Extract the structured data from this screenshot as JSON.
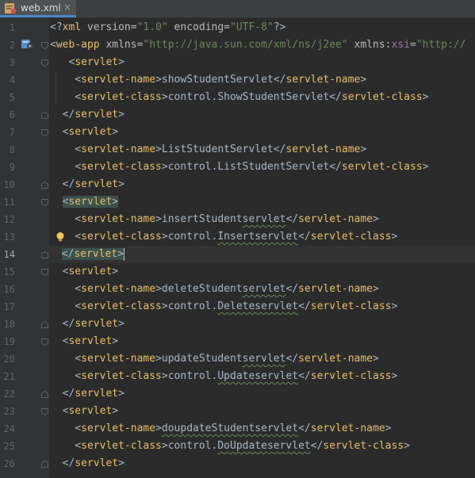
{
  "tab": {
    "title": "web.xml",
    "close": "×"
  },
  "lines": [
    {
      "n": "1",
      "indent": 0,
      "tokens": [
        {
          "c": "b",
          "t": "<?"
        },
        {
          "c": "t",
          "t": "xml "
        },
        {
          "c": "at",
          "t": "version="
        },
        {
          "c": "av",
          "t": "\"1.0\""
        },
        {
          "c": "at",
          "t": " encoding="
        },
        {
          "c": "av",
          "t": "\"UTF-8\""
        },
        {
          "c": "b",
          "t": "?>"
        }
      ]
    },
    {
      "n": "2",
      "indent": 0,
      "tokens": [
        {
          "c": "b",
          "t": "<"
        },
        {
          "c": "t",
          "t": "web-app "
        },
        {
          "c": "at",
          "t": "xmlns="
        },
        {
          "c": "av",
          "t": "\"http://java.sun.com/xml/ns/j2ee\""
        },
        {
          "c": "at",
          "t": " xmlns:"
        },
        {
          "c": "ns",
          "t": "xsi"
        },
        {
          "c": "at",
          "t": "="
        },
        {
          "c": "av",
          "t": "\"http://"
        }
      ]
    },
    {
      "n": "3",
      "indent": 3,
      "tokens": [
        {
          "c": "b",
          "t": "<"
        },
        {
          "c": "t",
          "t": "servlet"
        },
        {
          "c": "b",
          "t": ">"
        }
      ]
    },
    {
      "n": "4",
      "indent": 4,
      "tokens": [
        {
          "c": "b",
          "t": "<"
        },
        {
          "c": "t",
          "t": "servlet-name"
        },
        {
          "c": "b",
          "t": ">showStudentServlet</"
        },
        {
          "c": "t",
          "t": "servlet-name"
        },
        {
          "c": "b",
          "t": ">"
        }
      ]
    },
    {
      "n": "5",
      "indent": 4,
      "tokens": [
        {
          "c": "b",
          "t": "<"
        },
        {
          "c": "t",
          "t": "servlet-class"
        },
        {
          "c": "b",
          "t": ">control.ShowStudentServlet</"
        },
        {
          "c": "t",
          "t": "servlet-class"
        },
        {
          "c": "b",
          "t": ">"
        }
      ]
    },
    {
      "n": "6",
      "indent": 2,
      "tokens": [
        {
          "c": "b",
          "t": "</"
        },
        {
          "c": "t",
          "t": "servlet"
        },
        {
          "c": "b",
          "t": ">"
        }
      ]
    },
    {
      "n": "7",
      "indent": 2,
      "tokens": [
        {
          "c": "b",
          "t": "<"
        },
        {
          "c": "t",
          "t": "servlet"
        },
        {
          "c": "b",
          "t": ">"
        }
      ]
    },
    {
      "n": "8",
      "indent": 4,
      "tokens": [
        {
          "c": "b",
          "t": "<"
        },
        {
          "c": "t",
          "t": "servlet-name"
        },
        {
          "c": "b",
          "t": ">ListStudentServlet</"
        },
        {
          "c": "t",
          "t": "servlet-name"
        },
        {
          "c": "b",
          "t": ">"
        }
      ]
    },
    {
      "n": "9",
      "indent": 4,
      "tokens": [
        {
          "c": "b",
          "t": "<"
        },
        {
          "c": "t",
          "t": "servlet-class"
        },
        {
          "c": "b",
          "t": ">control.ListStudentServlet</"
        },
        {
          "c": "t",
          "t": "servlet-class"
        },
        {
          "c": "b",
          "t": ">"
        }
      ]
    },
    {
      "n": "10",
      "indent": 2,
      "tokens": [
        {
          "c": "b",
          "t": "</"
        },
        {
          "c": "t",
          "t": "servlet"
        },
        {
          "c": "b",
          "t": ">"
        }
      ]
    },
    {
      "n": "11",
      "indent": 2,
      "hl": true,
      "tokens": [
        {
          "c": "b",
          "t": "<"
        },
        {
          "c": "t",
          "t": "servlet"
        },
        {
          "c": "b",
          "t": ">"
        }
      ]
    },
    {
      "n": "12",
      "indent": 4,
      "tokens": [
        {
          "c": "b",
          "t": "<"
        },
        {
          "c": "t",
          "t": "servlet-name"
        },
        {
          "c": "b",
          "t": ">insertStudent"
        },
        {
          "c": "b sq",
          "t": "servlet"
        },
        {
          "c": "b",
          "t": "</"
        },
        {
          "c": "t",
          "t": "servlet-name"
        },
        {
          "c": "b",
          "t": ">"
        }
      ]
    },
    {
      "n": "13",
      "indent": 4,
      "tokens": [
        {
          "c": "b",
          "t": "<"
        },
        {
          "c": "t",
          "t": "servlet-class"
        },
        {
          "c": "b",
          "t": ">control."
        },
        {
          "c": "b sq",
          "t": "Insertservlet"
        },
        {
          "c": "b",
          "t": "</"
        },
        {
          "c": "t",
          "t": "servlet-class"
        },
        {
          "c": "b",
          "t": ">"
        }
      ]
    },
    {
      "n": "14",
      "indent": 2,
      "hl": true,
      "cur": true,
      "tokens": [
        {
          "c": "b",
          "t": "</"
        },
        {
          "c": "t",
          "t": "servlet"
        },
        {
          "c": "b",
          "t": ">"
        }
      ]
    },
    {
      "n": "15",
      "indent": 2,
      "tokens": [
        {
          "c": "b",
          "t": "<"
        },
        {
          "c": "t",
          "t": "servlet"
        },
        {
          "c": "b",
          "t": ">"
        }
      ]
    },
    {
      "n": "16",
      "indent": 4,
      "tokens": [
        {
          "c": "b",
          "t": "<"
        },
        {
          "c": "t",
          "t": "servlet-name"
        },
        {
          "c": "b",
          "t": ">deleteStudent"
        },
        {
          "c": "b sq",
          "t": "servlet"
        },
        {
          "c": "b",
          "t": "</"
        },
        {
          "c": "t",
          "t": "servlet-name"
        },
        {
          "c": "b",
          "t": ">"
        }
      ]
    },
    {
      "n": "17",
      "indent": 4,
      "tokens": [
        {
          "c": "b",
          "t": "<"
        },
        {
          "c": "t",
          "t": "servlet-class"
        },
        {
          "c": "b",
          "t": ">control."
        },
        {
          "c": "b sq",
          "t": "Deleteservlet"
        },
        {
          "c": "b",
          "t": "</"
        },
        {
          "c": "t",
          "t": "servlet-class"
        },
        {
          "c": "b",
          "t": ">"
        }
      ]
    },
    {
      "n": "18",
      "indent": 2,
      "tokens": [
        {
          "c": "b",
          "t": "</"
        },
        {
          "c": "t",
          "t": "servlet"
        },
        {
          "c": "b",
          "t": ">"
        }
      ]
    },
    {
      "n": "19",
      "indent": 2,
      "tokens": [
        {
          "c": "b",
          "t": "<"
        },
        {
          "c": "t",
          "t": "servlet"
        },
        {
          "c": "b",
          "t": ">"
        }
      ]
    },
    {
      "n": "20",
      "indent": 4,
      "tokens": [
        {
          "c": "b",
          "t": "<"
        },
        {
          "c": "t",
          "t": "servlet-name"
        },
        {
          "c": "b",
          "t": ">updateStudent"
        },
        {
          "c": "b sq",
          "t": "servlet"
        },
        {
          "c": "b",
          "t": "</"
        },
        {
          "c": "t",
          "t": "servlet-name"
        },
        {
          "c": "b",
          "t": ">"
        }
      ]
    },
    {
      "n": "21",
      "indent": 4,
      "tokens": [
        {
          "c": "b",
          "t": "<"
        },
        {
          "c": "t",
          "t": "servlet-class"
        },
        {
          "c": "b",
          "t": ">control."
        },
        {
          "c": "b sq",
          "t": "Updateservlet"
        },
        {
          "c": "b",
          "t": "</"
        },
        {
          "c": "t",
          "t": "servlet-class"
        },
        {
          "c": "b",
          "t": ">"
        }
      ]
    },
    {
      "n": "22",
      "indent": 2,
      "tokens": [
        {
          "c": "b",
          "t": "</"
        },
        {
          "c": "t",
          "t": "servlet"
        },
        {
          "c": "b",
          "t": ">"
        }
      ]
    },
    {
      "n": "23",
      "indent": 2,
      "tokens": [
        {
          "c": "b",
          "t": "<"
        },
        {
          "c": "t",
          "t": "servlet"
        },
        {
          "c": "b",
          "t": ">"
        }
      ]
    },
    {
      "n": "24",
      "indent": 4,
      "tokens": [
        {
          "c": "b",
          "t": "<"
        },
        {
          "c": "t",
          "t": "servlet-name"
        },
        {
          "c": "b",
          "t": ">"
        },
        {
          "c": "b sq",
          "t": "doupdateStudentservlet"
        },
        {
          "c": "b",
          "t": "</"
        },
        {
          "c": "t",
          "t": "servlet-name"
        },
        {
          "c": "b",
          "t": ">"
        }
      ]
    },
    {
      "n": "25",
      "indent": 4,
      "tokens": [
        {
          "c": "b",
          "t": "<"
        },
        {
          "c": "t",
          "t": "servlet-class"
        },
        {
          "c": "b",
          "t": ">control."
        },
        {
          "c": "b sq",
          "t": "DoUpdateservlet"
        },
        {
          "c": "b",
          "t": "</"
        },
        {
          "c": "t",
          "t": "servlet-class"
        },
        {
          "c": "b",
          "t": ">"
        }
      ]
    },
    {
      "n": "26",
      "indent": 2,
      "tokens": [
        {
          "c": "b",
          "t": "</"
        },
        {
          "c": "t",
          "t": "servlet"
        },
        {
          "c": "b",
          "t": ">"
        }
      ]
    }
  ],
  "gutter_icons": {
    "line2": "web-xml-run-icon",
    "line13": "intention-bulb-icon"
  },
  "colors": {
    "background": "#2b2b2b",
    "gutter": "#313335",
    "tag": "#e8bf6a",
    "attr_value": "#6a8759",
    "namespace": "#9876aa",
    "text": "#a9b7c6"
  }
}
